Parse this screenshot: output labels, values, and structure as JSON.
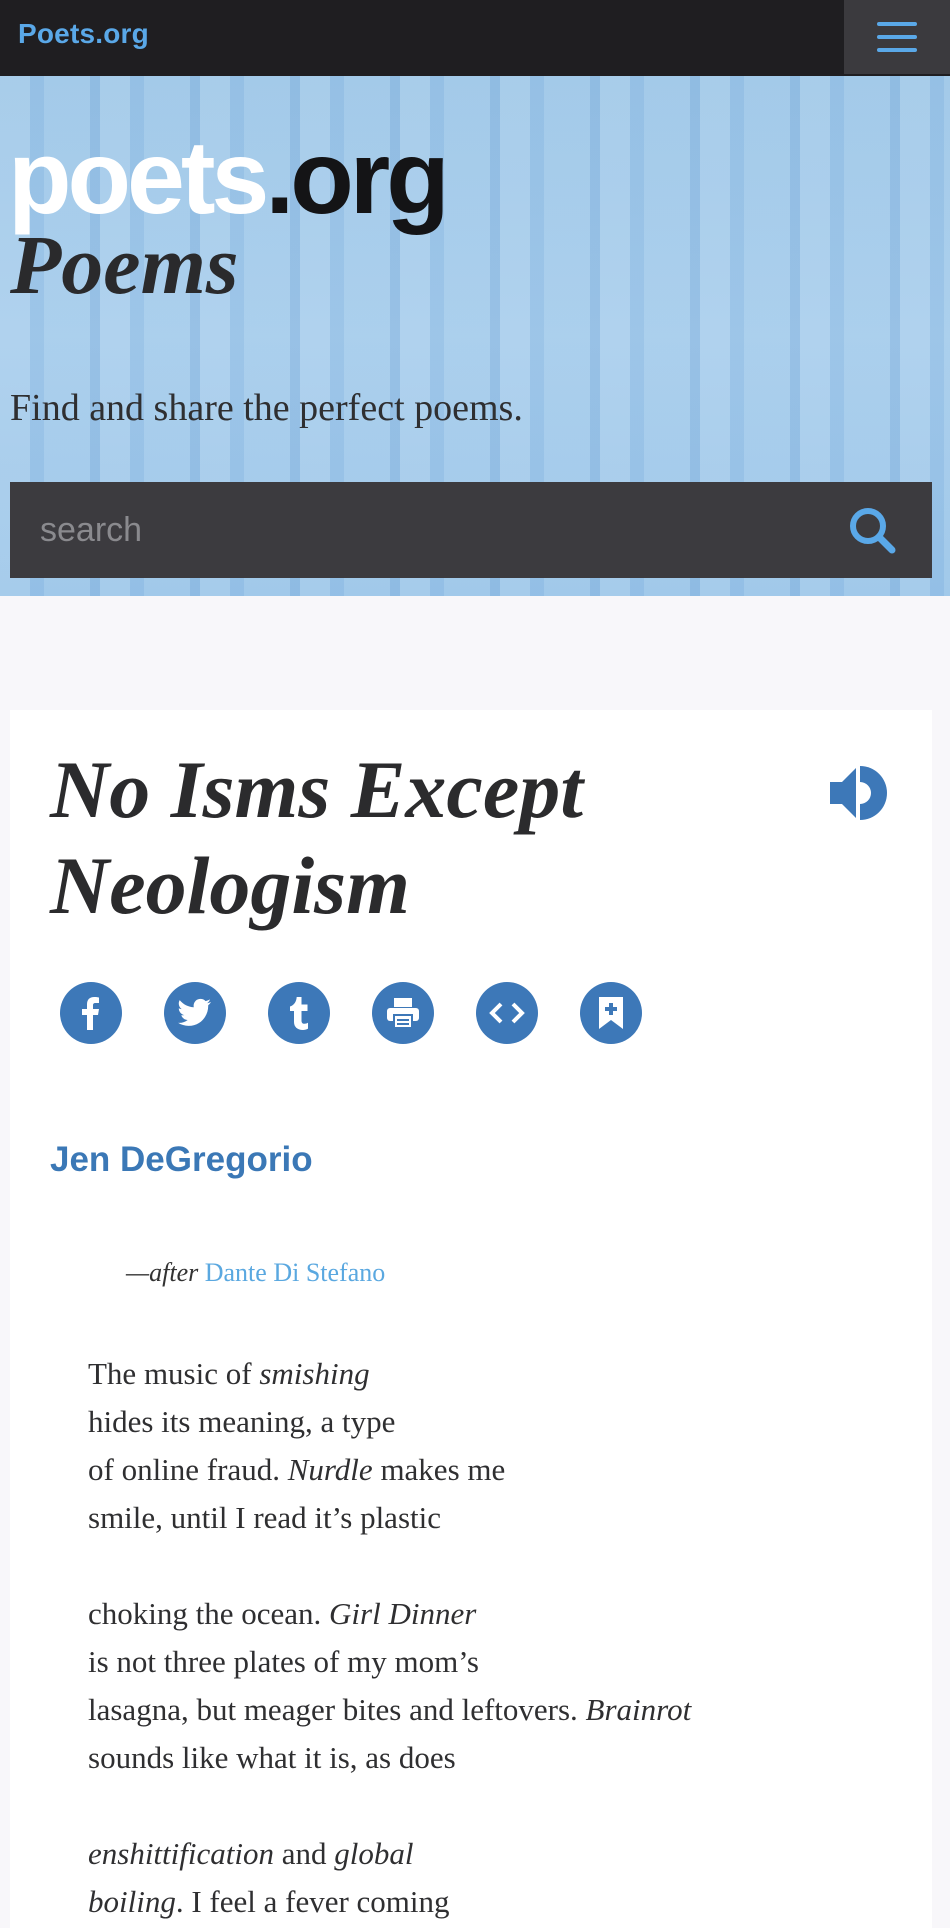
{
  "header": {
    "site_link": "Poets.org",
    "menu_icon": "hamburger-menu-icon"
  },
  "hero": {
    "logo_light": "poets",
    "logo_dark": ".org",
    "title": "Poems",
    "subtitle": "Find and share the perfect poems.",
    "search_placeholder": "search",
    "search_icon": "search-icon"
  },
  "poem": {
    "title": "No Isms Except Neologism",
    "audio_icon": "audio-play-icon",
    "share": [
      {
        "name": "facebook-icon"
      },
      {
        "name": "twitter-icon"
      },
      {
        "name": "tumblr-icon"
      },
      {
        "name": "print-icon"
      },
      {
        "name": "embed-icon"
      },
      {
        "name": "bookmark-add-icon"
      }
    ],
    "author": "Jen DeGregorio",
    "dedication_prefix": "—after",
    "dedication_name": "Dante Di Stefano",
    "stanzas": [
      [
        [
          {
            "t": "The music of "
          },
          {
            "t": "smishing",
            "i": true
          }
        ],
        [
          {
            "t": "hides its meaning, a type"
          }
        ],
        [
          {
            "t": "of online fraud. "
          },
          {
            "t": "Nurdle",
            "i": true
          },
          {
            "t": " makes me"
          }
        ],
        [
          {
            "t": "smile, until I read it’s plastic"
          }
        ]
      ],
      [
        [
          {
            "t": "choking the ocean. "
          },
          {
            "t": "Girl Dinner",
            "i": true
          }
        ],
        [
          {
            "t": "is not three plates of my mom’s"
          }
        ],
        [
          {
            "t": "lasagna, but meager bites and leftovers. "
          },
          {
            "t": "Brainrot",
            "i": true
          }
        ],
        [
          {
            "t": "sounds like what it is, as does"
          }
        ]
      ],
      [
        [
          {
            "t": "enshittification",
            "i": true
          },
          {
            "t": " and "
          },
          {
            "t": "global",
            "i": true
          }
        ],
        [
          {
            "t": "boiling",
            "i": true
          },
          {
            "t": ". I feel a fever coming"
          }
        ]
      ]
    ]
  },
  "colors": {
    "accent_blue": "#3d78b8",
    "link_blue": "#5aa8e0",
    "topbar": "#1f1e21",
    "search_bg": "#3c3b3f"
  }
}
